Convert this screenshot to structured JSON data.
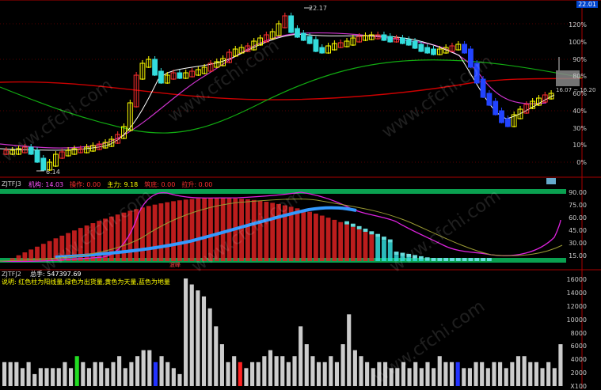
{
  "watermark_text": "www.cfchi.com",
  "price_panel": {
    "top_right_value": "22.01",
    "high_label": "22.17",
    "low_label": "6.14",
    "box_label": "16.07 ~ 16.20",
    "right_axis": [
      "120%",
      "100%",
      "90%",
      "80%",
      "60%",
      "40%",
      "30%",
      "10%",
      "0%"
    ]
  },
  "ind_panel": {
    "name": "ZJTFJ3",
    "items": [
      {
        "label": "机构",
        "value": "14.03",
        "color": "#ff55ff"
      },
      {
        "label": "操作",
        "value": "0.00",
        "color": "#ff3030"
      },
      {
        "label": "主力",
        "value": "9.18",
        "color": "#ffff00"
      },
      {
        "label": "筑底",
        "value": "0.00",
        "color": "#ff3030"
      },
      {
        "label": "拉升",
        "value": "0.00",
        "color": "#ff3030"
      }
    ],
    "right_axis": [
      "90.00",
      "75.00",
      "60.00",
      "45.00",
      "30.00",
      "15.00"
    ],
    "badge": "波峰"
  },
  "vol_panel": {
    "name": "ZJTFJ2",
    "total_label": "总手: 547397.69",
    "legend": "说明: 红色柱为阳线量,绿色为出货量,黄色为天量,蓝色为地量",
    "right_axis": [
      "16000",
      "14000",
      "12000",
      "10000",
      "8000",
      "6000",
      "4000",
      "2000",
      "X100"
    ]
  },
  "chart_data": {
    "type": "bar",
    "volume": [
      4,
      4,
      4,
      3,
      4,
      2,
      3,
      3,
      3,
      3,
      4,
      3,
      5,
      4,
      3,
      4,
      4,
      3,
      4,
      5,
      3,
      4,
      5,
      6,
      6,
      4,
      5,
      4,
      3,
      2,
      18,
      17,
      16,
      15,
      13,
      10,
      7,
      4,
      5,
      4,
      3,
      4,
      4,
      5,
      6,
      5,
      5,
      4,
      5,
      10,
      7,
      5,
      4,
      4,
      5,
      4,
      7,
      12,
      6,
      5,
      4,
      3,
      4,
      4,
      3,
      3,
      4,
      3,
      4,
      3,
      4,
      3,
      5,
      4,
      4,
      4,
      3,
      3,
      4,
      4,
      3,
      4,
      4,
      3,
      4,
      5,
      5,
      4,
      4,
      3,
      4,
      3,
      7
    ]
  }
}
